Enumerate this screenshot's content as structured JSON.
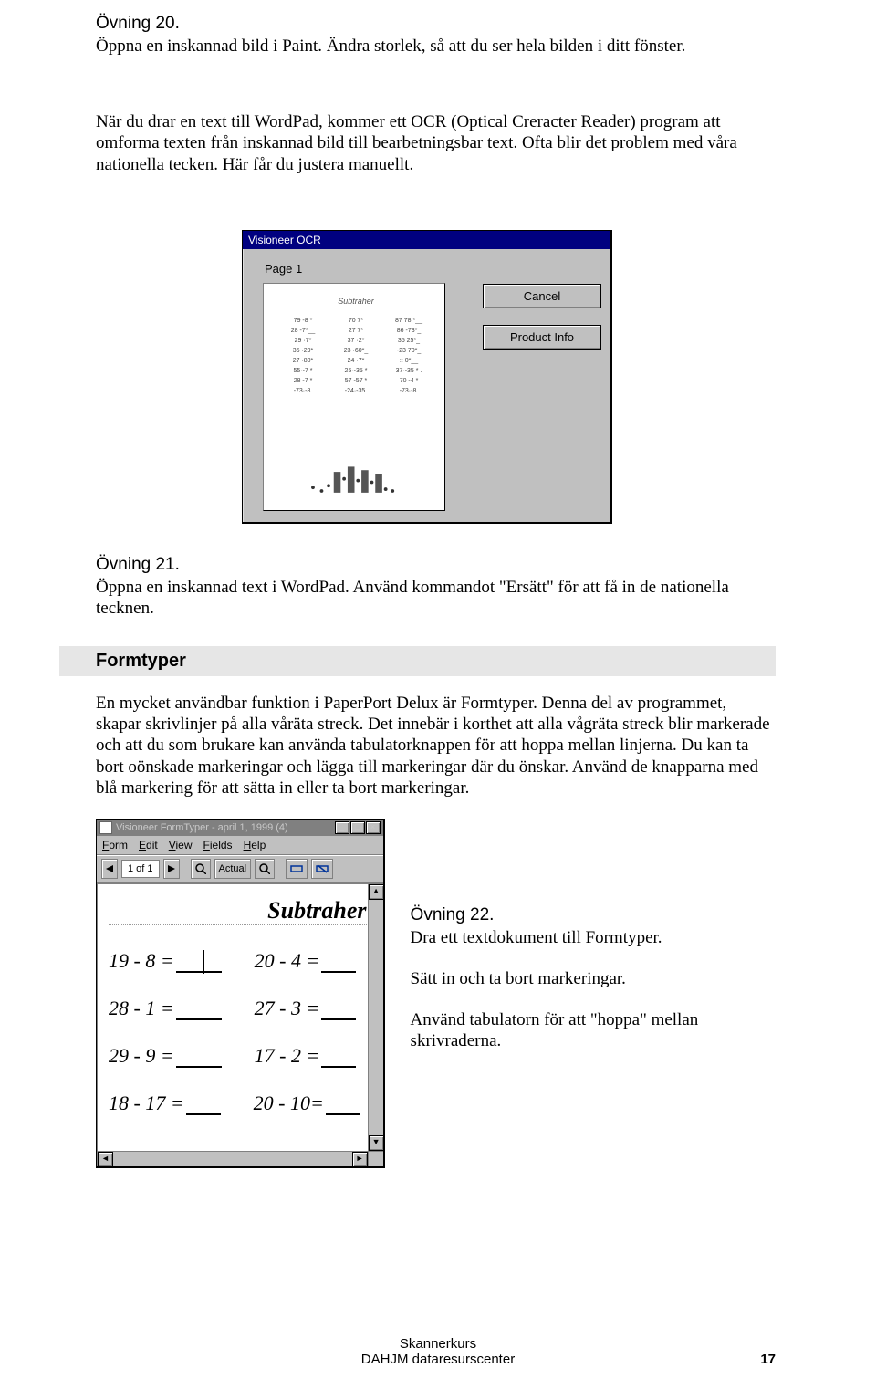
{
  "ex20": {
    "title": "Övning 20.",
    "body": "Öppna en inskannad bild i Paint. Ändra storlek, så att du ser hela bilden i ditt fönster."
  },
  "para1": "När du drar en text till WordPad, kommer ett OCR (Optical Creracter Reader) program att omforma texten från inskannad bild till bearbetningsbar text. Ofta blir det problem med våra nationella tecken. Här får du justera manuellt.",
  "ocr": {
    "title": "Visioneer OCR",
    "page_label": "Page 1",
    "cancel": "Cancel",
    "product": "Product Info",
    "preview_title": "Subtraher"
  },
  "ex21": {
    "title": "Övning 21.",
    "body": "Öppna en inskannad text i WordPad. Använd kommandot \"Ersätt\" för att få in de nationella tecknen."
  },
  "section": "Formtyper",
  "para2": "En mycket användbar funktion i PaperPort Delux är Formtyper. Denna del av programmet, skapar skrivlinjer på alla våräta streck. Det innebär i korthet att alla vågräta streck blir markerade och att du som brukare kan använda tabulatorknappen för att hoppa mellan linjerna. Du kan ta bort oönskade markeringar och lägga till markeringar där du önskar. Använd de knapparna med blå markering för att sätta in eller ta bort markeringar.",
  "ft": {
    "title": "Visioneer FormTyper - april 1, 1999 (4)",
    "menu": [
      "Form",
      "Edit",
      "View",
      "Fields",
      "Help"
    ],
    "page_ind": "1 of 1",
    "actual": "Actual",
    "doc_title": "Subtraher",
    "rows": [
      [
        "19 - 8 =",
        "20 - 4 ="
      ],
      [
        "28 - 1 =",
        "27 - 3 ="
      ],
      [
        "29 - 9 =",
        "17 - 2 ="
      ],
      [
        "18 - 17 =",
        "20 - 10="
      ]
    ]
  },
  "ex22": {
    "title": "Övning 22.",
    "l1": "Dra ett textdokument till Formtyper.",
    "l2": "Sätt in och ta bort markeringar.",
    "l3": "Använd tabulatorn för att \"hoppa\" mellan skrivraderna."
  },
  "footer": {
    "l1": "Skannerkurs",
    "l2": "DAHJM dataresurscenter",
    "page": "17"
  }
}
